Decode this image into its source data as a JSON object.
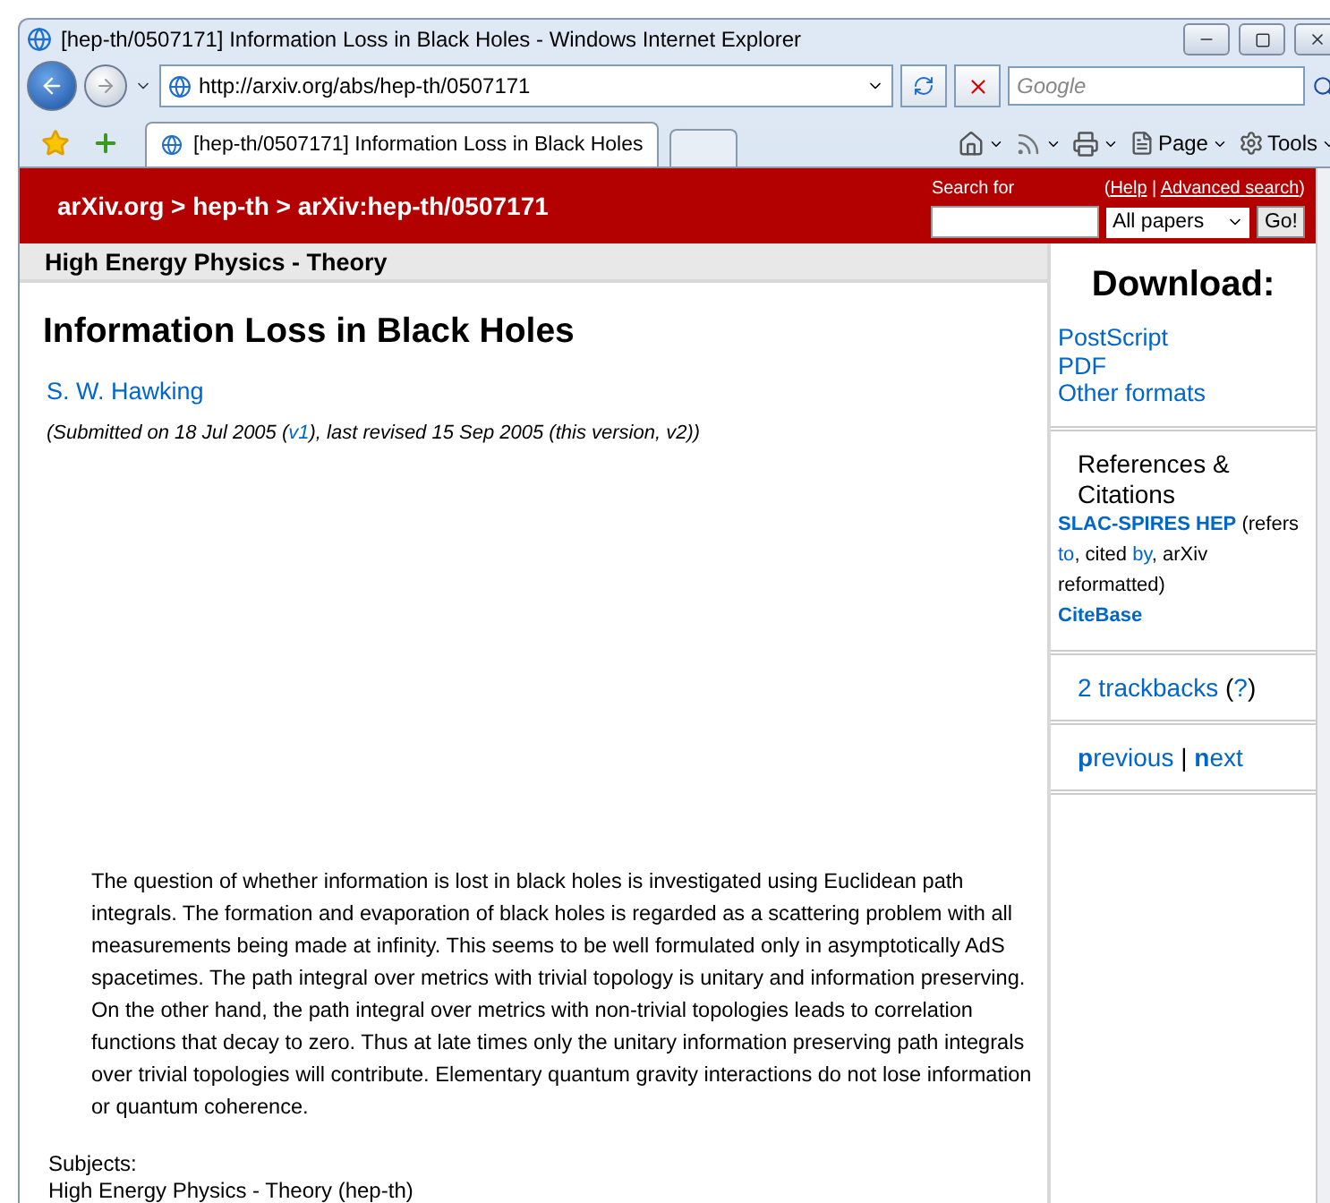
{
  "window": {
    "title": "[hep-th/0507171] Information Loss in Black Holes - Windows Internet Explorer"
  },
  "address_bar": {
    "url": "http://arxiv.org/abs/hep-th/0507171"
  },
  "search_box": {
    "placeholder": "Google"
  },
  "tabs": [
    {
      "label": "[hep-th/0507171] Information Loss in Black Holes",
      "selected": true
    }
  ],
  "command_bar": [
    {
      "kind": "home"
    },
    {
      "kind": "feed"
    },
    {
      "kind": "print"
    },
    {
      "kind": "page",
      "label": "Page"
    },
    {
      "kind": "tools",
      "label": "Tools"
    }
  ],
  "header": {
    "breadcrumb": "arXiv.org > hep-th > arXiv:hep-th/0507171",
    "search_label": "Search for",
    "help_links": [
      {
        "text": "(",
        "kind": "text"
      },
      {
        "text": "Help",
        "kind": "link"
      },
      {
        "text": " | ",
        "kind": "text"
      },
      {
        "text": "Advanced search",
        "kind": "link"
      },
      {
        "text": ")",
        "kind": "text"
      }
    ],
    "scope": "All papers",
    "go": "Go!"
  },
  "subject_heading": "High Energy Physics - Theory",
  "paper": {
    "title": "Information Loss in Black Holes",
    "author": "S. W. Hawking",
    "dateline": [
      {
        "text": "(Submitted on 18 Jul 2005 (",
        "kind": "text"
      },
      {
        "text": "v1",
        "kind": "link"
      },
      {
        "text": "), last revised 15 Sep 2005 (this version, v2))",
        "kind": "text"
      }
    ],
    "abstract": "The question of whether information is lost in black holes is investigated using Euclidean path integrals. The formation and evaporation of black holes is regarded as a scattering problem with all measurements being made at infinity. This seems to be well formulated only in asymptotically AdS spacetimes. The path integral over metrics with trivial topology is unitary and information preserving. On the other hand, the path integral over metrics with non-trivial topologies leads to correlation functions that decay to zero. Thus at late times only the unitary information preserving path integrals over trivial topologies will contribute. Elementary quantum gravity interactions do not lose information or quantum coherence.",
    "subjects_label": "Subjects:",
    "subjects": "High Energy Physics - Theory (hep-th)"
  },
  "sidebar": {
    "download": {
      "heading": "Download:",
      "links": [
        "PostScript",
        "PDF",
        "Other formats"
      ]
    },
    "references": {
      "heading": "References & Citations",
      "parts": [
        {
          "text": "SLAC-SPIRES HEP",
          "kind": "strong-link"
        },
        {
          "text": " (refers ",
          "kind": "text"
        },
        {
          "text": "to",
          "kind": "link"
        },
        {
          "text": ", cited ",
          "kind": "text"
        },
        {
          "text": "by",
          "kind": "link"
        },
        {
          "text": ", arXiv reformatted)",
          "kind": "text"
        }
      ],
      "citebase": "CiteBase"
    },
    "trackbacks": [
      {
        "text": "2 trackbacks",
        "kind": "link"
      },
      {
        "text": " (",
        "kind": "text"
      },
      {
        "text": "?",
        "kind": "link"
      },
      {
        "text": ")",
        "kind": "text"
      }
    ],
    "navigation": [
      {
        "text": "**p**revious",
        "kind": "link"
      },
      {
        "text": " | ",
        "kind": "text"
      },
      {
        "text": "**n**ext",
        "kind": "link"
      }
    ]
  }
}
